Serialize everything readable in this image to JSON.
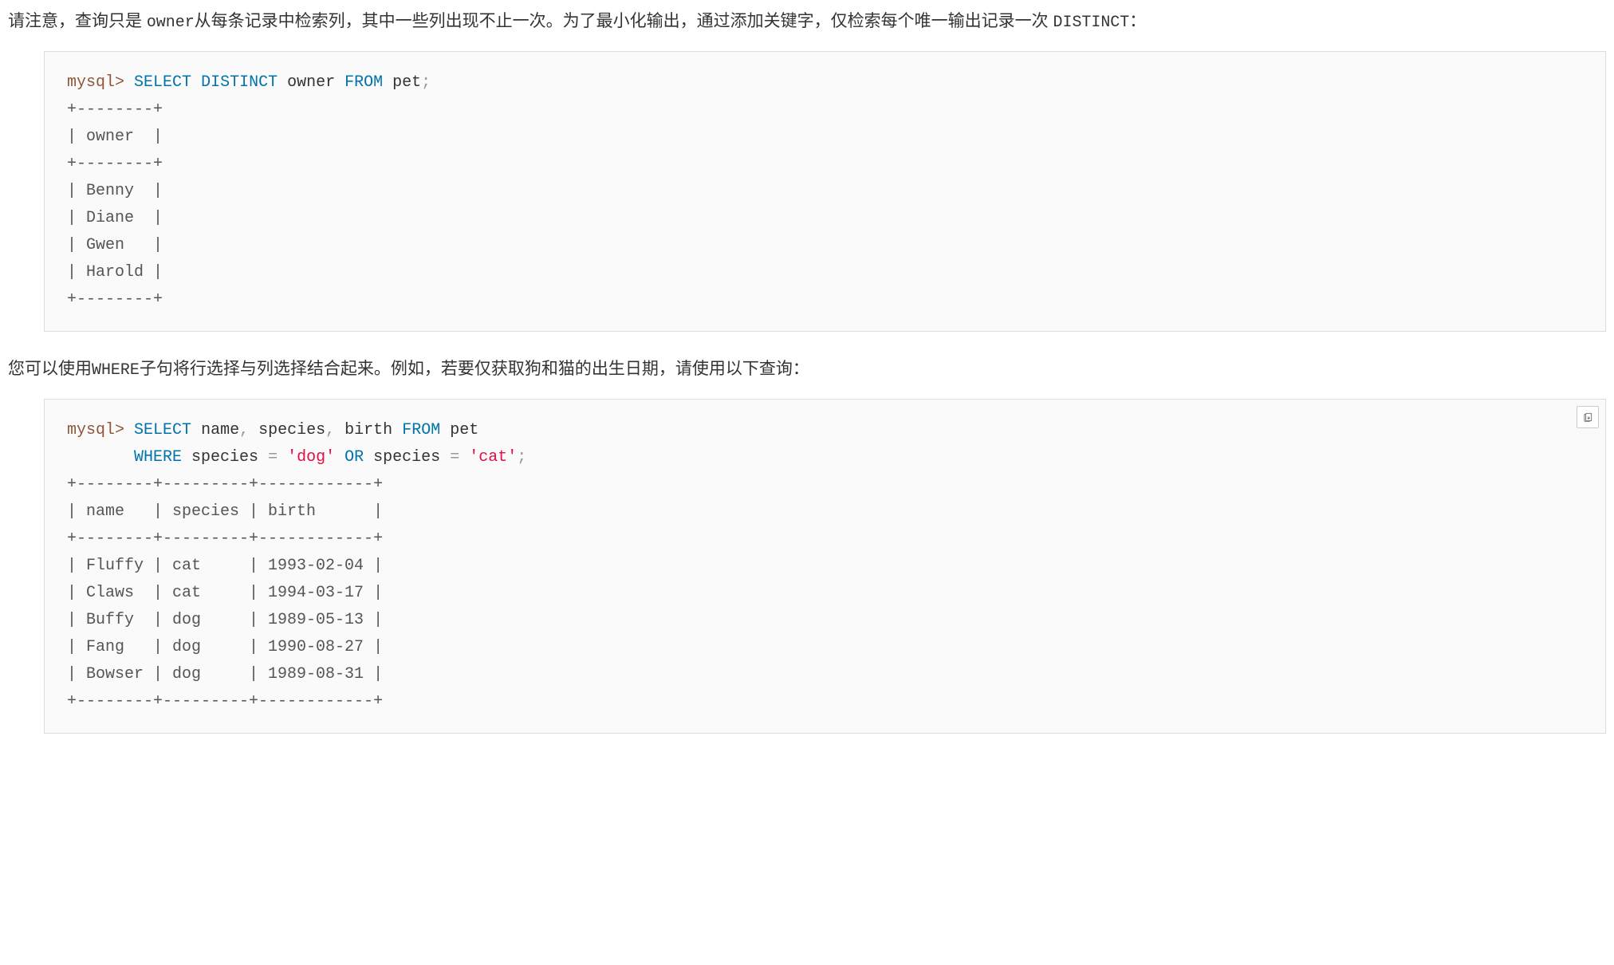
{
  "para1": {
    "t1": "请注意，查询只是 ",
    "code1": "owner",
    "t2": "从每条记录中检索列，其中一些列出现不止一次。为了最小化输出，通过添加关键字，仅检索每个唯一输出记录一次 ",
    "code2": "DISTINCT",
    "t3": "："
  },
  "code1": {
    "prompt": "mysql>",
    "sp1": " ",
    "select": "SELECT",
    "sp2": " ",
    "distinct": "DISTINCT",
    "sp3": " ",
    "owner": "owner",
    "sp4": " ",
    "from": "FROM",
    "sp5": " ",
    "pet": "pet",
    "semi": ";",
    "output": "\n+--------+\n| owner  |\n+--------+\n| Benny  |\n| Diane  |\n| Gwen   |\n| Harold |\n+--------+"
  },
  "para2": {
    "t1": "您可以使用",
    "code1": "WHERE",
    "t2": "子句将行选择与列选择结合起来。例如，若要仅获取狗和猫的出生日期，请使用以下查询："
  },
  "code2": {
    "prompt": "mysql>",
    "sp1": " ",
    "select": "SELECT",
    "sp2": " ",
    "name": "name",
    "c1": ",",
    "sp3": " ",
    "species": "species",
    "c2": ",",
    "sp4": " ",
    "birth": "birth",
    "sp5": " ",
    "from": "FROM",
    "sp6": " ",
    "pet": "pet",
    "nl1": "\n       ",
    "where": "WHERE",
    "sp7": " ",
    "species2": "species",
    "sp8": " ",
    "eq1": "=",
    "sp9": " ",
    "dog": "'dog'",
    "sp10": " ",
    "or": "OR",
    "sp11": " ",
    "species3": "species",
    "sp12": " ",
    "eq2": "=",
    "sp13": " ",
    "cat": "'cat'",
    "semi": ";",
    "output": "\n+--------+---------+------------+\n| name   | species | birth      |\n+--------+---------+------------+\n| Fluffy | cat     | 1993-02-04 |\n| Claws  | cat     | 1994-03-17 |\n| Buffy  | dog     | 1989-05-13 |\n| Fang   | dog     | 1990-08-27 |\n| Bowser | dog     | 1989-08-31 |\n+--------+---------+------------+"
  }
}
